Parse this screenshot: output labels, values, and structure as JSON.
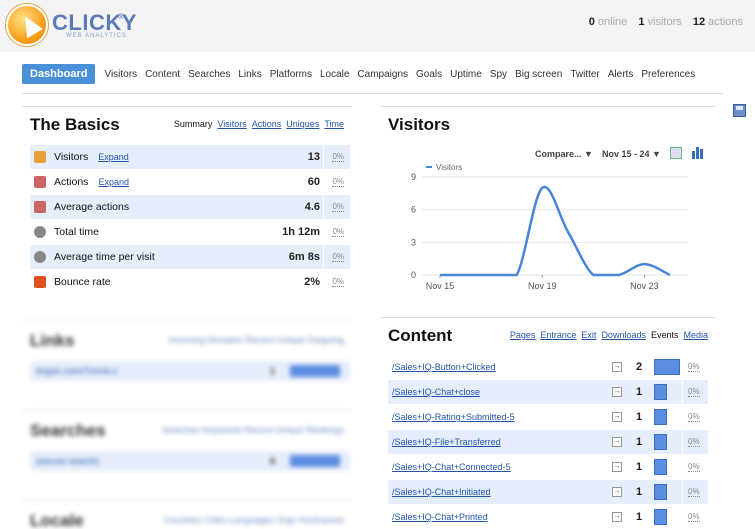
{
  "header": {
    "brand": "CLICKY",
    "brand_sub": "WEB ANALYTICS",
    "online_count": "0",
    "online_label": "online",
    "visitors_count": "1",
    "visitors_label": "visitors",
    "actions_count": "12",
    "actions_label": "actions"
  },
  "nav": {
    "items": [
      "Dashboard",
      "Visitors",
      "Content",
      "Searches",
      "Links",
      "Platforms",
      "Locale",
      "Campaigns",
      "Goals",
      "Uptime",
      "Spy",
      "Big screen",
      "Twitter",
      "Alerts",
      "Preferences"
    ],
    "active": "Dashboard"
  },
  "basics": {
    "title": "The Basics",
    "tabs": [
      "Summary",
      "Visitors",
      "Actions",
      "Uniques",
      "Time"
    ],
    "expand_label": "Expand",
    "rows": [
      {
        "label": "Visitors",
        "value": "13",
        "pct": "0%",
        "expand": true,
        "icon": "visitors-icon"
      },
      {
        "label": "Actions",
        "value": "60",
        "pct": "0%",
        "expand": true,
        "icon": "actions-icon"
      },
      {
        "label": "Average actions",
        "value": "4.6",
        "pct": "0%",
        "expand": false,
        "icon": "average-actions-icon"
      },
      {
        "label": "Total time",
        "value": "1h 12m",
        "pct": "0%",
        "expand": false,
        "icon": "clock-icon"
      },
      {
        "label": "Average time per visit",
        "value": "6m 8s",
        "pct": "0%",
        "expand": false,
        "icon": "clock-icon"
      },
      {
        "label": "Bounce rate",
        "value": "2%",
        "pct": "0%",
        "expand": false,
        "icon": "bounce-icon"
      }
    ]
  },
  "visitors_panel": {
    "title": "Visitors",
    "compare_label": "Compare... ▼",
    "date_range": "Nov 15 - 24 ▼"
  },
  "chart_data": {
    "type": "line",
    "series": [
      {
        "name": "Visitors",
        "color": "#4a86d8"
      }
    ],
    "x": [
      "Nov 15",
      "Nov 16",
      "Nov 17",
      "Nov 18",
      "Nov 19",
      "Nov 20",
      "Nov 21",
      "Nov 22",
      "Nov 23",
      "Nov 24"
    ],
    "values": [
      0,
      0,
      0,
      0,
      8,
      4,
      0,
      0,
      1,
      0
    ],
    "x_tick_labels": [
      "Nov 15",
      "Nov 19",
      "Nov 23"
    ],
    "y_ticks": [
      0,
      3,
      6,
      9
    ],
    "ylim": [
      0,
      9
    ],
    "legend": "top-left",
    "grid": true
  },
  "blurred": {
    "links_title": "Links",
    "links_tabs": "Incoming  Domains  Recent  Unique  Outgoing",
    "links_row": "tinypic.com/7cnrvk.o",
    "links_value": "1",
    "searches_title": "Searches",
    "searches_tabs": "Searches  Keywords  Recent  Unique  Rankings",
    "searches_row": "(secure search)",
    "searches_value": "6",
    "locale_title": "Locale",
    "locale_tabs": "Countries  Cities  Languages  Orgs  Hostnames"
  },
  "content_panel": {
    "title": "Content",
    "tabs": [
      "Pages",
      "Entrance",
      "Exit",
      "Downloads",
      "Events",
      "Media"
    ],
    "active_tab": "Events",
    "rows": [
      {
        "path": "/Sales+IQ-Button+Clicked",
        "count": "2",
        "pct": "0%",
        "bar": 1.0
      },
      {
        "path": "/Sales+IQ-Chat+close",
        "count": "1",
        "pct": "0%",
        "bar": 0.5
      },
      {
        "path": "/Sales+IQ-Rating+Submitted-5",
        "count": "1",
        "pct": "0%",
        "bar": 0.5
      },
      {
        "path": "/Sales+IQ-File+Transferred",
        "count": "1",
        "pct": "0%",
        "bar": 0.5
      },
      {
        "path": "/Sales+IQ-Chat+Connected-5",
        "count": "1",
        "pct": "0%",
        "bar": 0.5
      },
      {
        "path": "/Sales+IQ-Chat+Initiated",
        "count": "1",
        "pct": "0%",
        "bar": 0.5
      },
      {
        "path": "/Sales+IQ-Chat+Printed",
        "count": "1",
        "pct": "0%",
        "bar": 0.5
      }
    ]
  }
}
